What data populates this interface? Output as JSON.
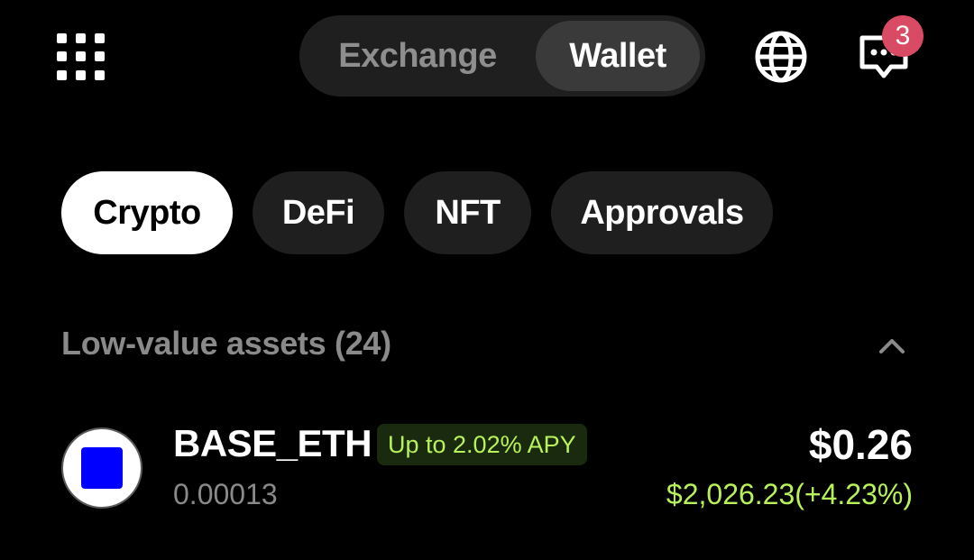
{
  "header": {
    "menu_icon": "grid-menu-icon",
    "tabs": [
      {
        "label": "Exchange",
        "active": false
      },
      {
        "label": "Wallet",
        "active": true
      }
    ],
    "language_icon": "globe-icon",
    "messages_icon": "chat-bubble-icon",
    "messages_badge": "3"
  },
  "filters": {
    "chips": [
      {
        "label": "Crypto",
        "active": true
      },
      {
        "label": "DeFi",
        "active": false
      },
      {
        "label": "NFT",
        "active": false
      },
      {
        "label": "Approvals",
        "active": false
      }
    ]
  },
  "section": {
    "title": "Low-value assets (24)",
    "toggle_icon": "chevron-up-icon"
  },
  "assets": [
    {
      "name": "BASE_ETH",
      "apy_badge": "Up to 2.02% APY",
      "quantity": "0.00013",
      "value": "$0.26",
      "price_change": "$2,026.23(+4.23%)",
      "logo_color": "#0000ff"
    }
  ],
  "colors": {
    "background": "#000000",
    "accent_green": "#b8f25a",
    "badge_red": "#d94a64",
    "muted_text": "#8a8a8a"
  }
}
